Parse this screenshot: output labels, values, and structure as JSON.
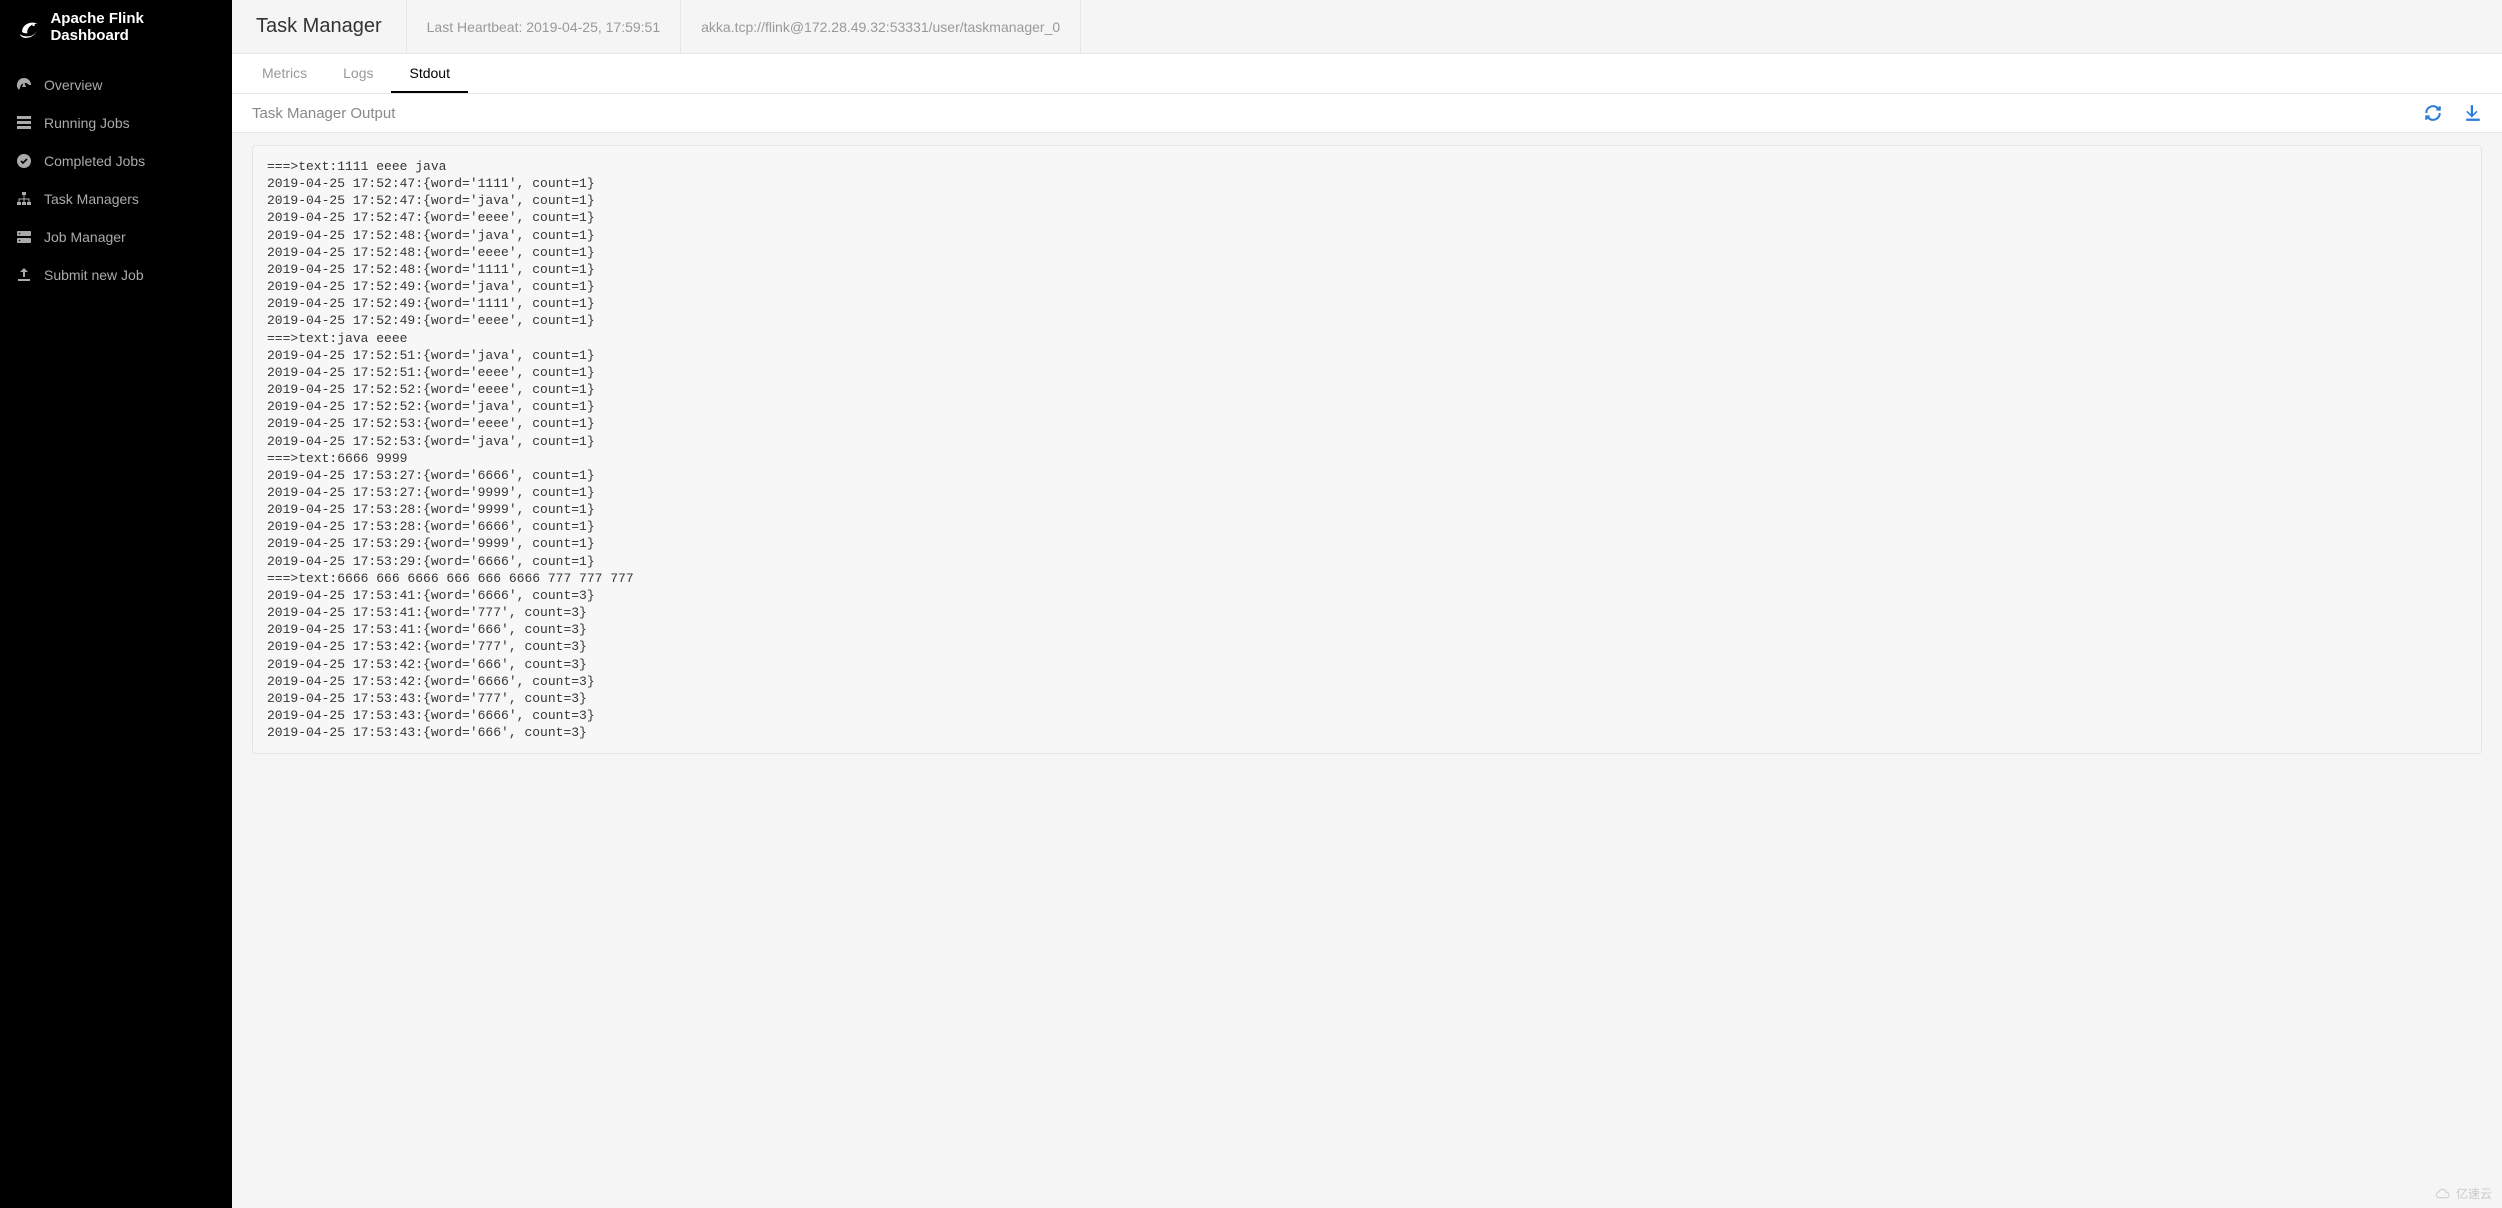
{
  "brand": {
    "title": "Apache Flink Dashboard"
  },
  "sidebar": {
    "items": [
      {
        "label": "Overview"
      },
      {
        "label": "Running Jobs"
      },
      {
        "label": "Completed Jobs"
      },
      {
        "label": "Task Managers"
      },
      {
        "label": "Job Manager"
      },
      {
        "label": "Submit new Job"
      }
    ]
  },
  "topbar": {
    "title": "Task Manager",
    "heartbeat": "Last Heartbeat: 2019-04-25, 17:59:51",
    "path": "akka.tcp://flink@172.28.49.32:53331/user/taskmanager_0"
  },
  "tabs": [
    {
      "label": "Metrics",
      "active": false
    },
    {
      "label": "Logs",
      "active": false
    },
    {
      "label": "Stdout",
      "active": true
    }
  ],
  "section": {
    "title": "Task Manager Output"
  },
  "watermark": {
    "text": "亿速云"
  },
  "output": "===>text:1111 eeee java\n2019-04-25 17:52:47:{word='1111', count=1}\n2019-04-25 17:52:47:{word='java', count=1}\n2019-04-25 17:52:47:{word='eeee', count=1}\n2019-04-25 17:52:48:{word='java', count=1}\n2019-04-25 17:52:48:{word='eeee', count=1}\n2019-04-25 17:52:48:{word='1111', count=1}\n2019-04-25 17:52:49:{word='java', count=1}\n2019-04-25 17:52:49:{word='1111', count=1}\n2019-04-25 17:52:49:{word='eeee', count=1}\n===>text:java eeee\n2019-04-25 17:52:51:{word='java', count=1}\n2019-04-25 17:52:51:{word='eeee', count=1}\n2019-04-25 17:52:52:{word='eeee', count=1}\n2019-04-25 17:52:52:{word='java', count=1}\n2019-04-25 17:52:53:{word='eeee', count=1}\n2019-04-25 17:52:53:{word='java', count=1}\n===>text:6666 9999\n2019-04-25 17:53:27:{word='6666', count=1}\n2019-04-25 17:53:27:{word='9999', count=1}\n2019-04-25 17:53:28:{word='9999', count=1}\n2019-04-25 17:53:28:{word='6666', count=1}\n2019-04-25 17:53:29:{word='9999', count=1}\n2019-04-25 17:53:29:{word='6666', count=1}\n===>text:6666 666 6666 666 666 6666 777 777 777\n2019-04-25 17:53:41:{word='6666', count=3}\n2019-04-25 17:53:41:{word='777', count=3}\n2019-04-25 17:53:41:{word='666', count=3}\n2019-04-25 17:53:42:{word='777', count=3}\n2019-04-25 17:53:42:{word='666', count=3}\n2019-04-25 17:53:42:{word='6666', count=3}\n2019-04-25 17:53:43:{word='777', count=3}\n2019-04-25 17:53:43:{word='6666', count=3}\n2019-04-25 17:53:43:{word='666', count=3}"
}
